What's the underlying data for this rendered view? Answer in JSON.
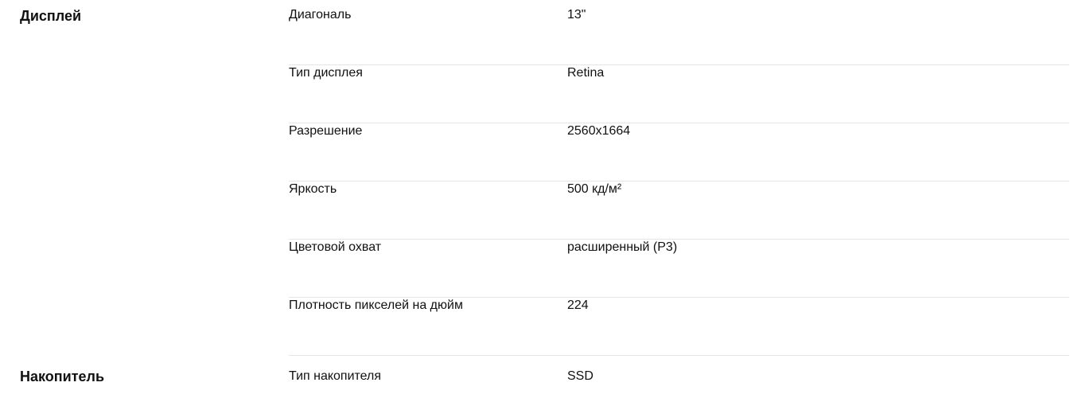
{
  "sections": [
    {
      "title": "Дисплей",
      "rows": [
        {
          "label": "Диагональ",
          "value": "13\""
        },
        {
          "label": "Тип дисплея",
          "value": "Retina"
        },
        {
          "label": "Разрешение",
          "value": "2560x1664"
        },
        {
          "label": "Яркость",
          "value": "500 кд/м²"
        },
        {
          "label": "Цветовой охват",
          "value": "расширенный (P3)"
        },
        {
          "label": "Плотность пикселей на дюйм",
          "value": "224"
        }
      ]
    },
    {
      "title": "Накопитель",
      "rows": [
        {
          "label": "Тип накопителя",
          "value": "SSD"
        }
      ]
    }
  ]
}
